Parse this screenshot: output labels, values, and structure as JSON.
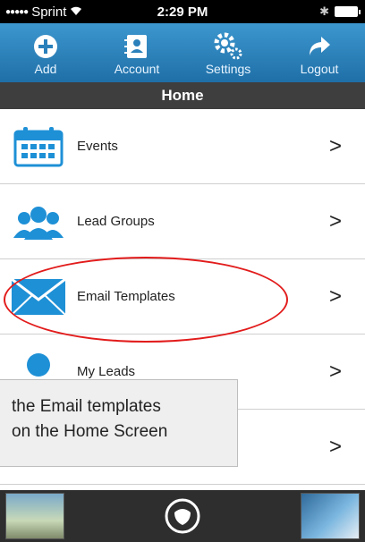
{
  "status_bar": {
    "carrier": "Sprint",
    "time": "2:29 PM"
  },
  "toolbar": {
    "items": [
      {
        "label": "Add",
        "icon": "plus-circle-icon"
      },
      {
        "label": "Account",
        "icon": "contact-card-icon"
      },
      {
        "label": "Settings",
        "icon": "gears-icon"
      },
      {
        "label": "Logout",
        "icon": "share-arrow-icon"
      }
    ]
  },
  "title": "Home",
  "menu": {
    "items": [
      {
        "label": "Events",
        "icon": "calendar-icon",
        "chevron": ">"
      },
      {
        "label": "Lead Groups",
        "icon": "people-group-icon",
        "chevron": ">"
      },
      {
        "label": "Email Templates",
        "icon": "envelope-icon",
        "chevron": ">"
      },
      {
        "label": "My Leads",
        "icon": "person-icon",
        "chevron": ">"
      },
      {
        "label": "",
        "icon": "list-icon",
        "chevron": ">"
      }
    ]
  },
  "tooltip": {
    "line1": "the Email templates",
    "line2": "on the Home Screen"
  },
  "colors": {
    "toolbar": "#2a80bb",
    "title_bar": "#3e3e3e",
    "icon_blue": "#1e90d6",
    "highlight": "#e21b1b"
  }
}
